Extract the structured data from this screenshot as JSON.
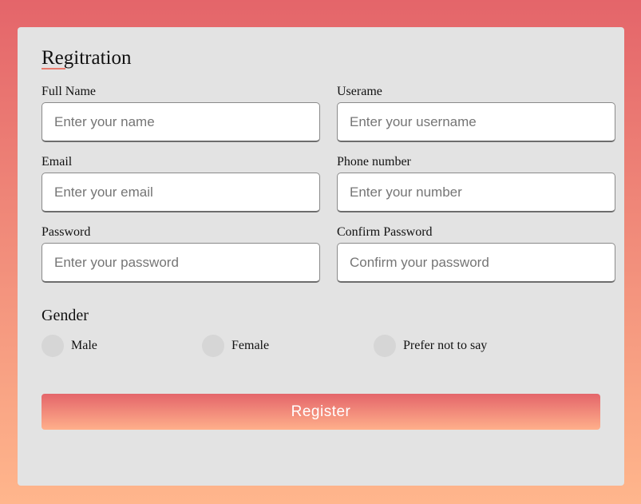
{
  "form": {
    "title": "Regitration",
    "fields": [
      {
        "label": "Full Name",
        "placeholder": "Enter your name",
        "value": ""
      },
      {
        "label": "Userame",
        "placeholder": "Enter your username",
        "value": ""
      },
      {
        "label": "Email",
        "placeholder": "Enter your email",
        "value": ""
      },
      {
        "label": "Phone number",
        "placeholder": "Enter your number",
        "value": ""
      },
      {
        "label": "Password",
        "placeholder": "Enter your password",
        "value": ""
      },
      {
        "label": "Confirm Password",
        "placeholder": "Confirm your password",
        "value": ""
      }
    ],
    "gender": {
      "title": "Gender",
      "options": [
        "Male",
        "Female",
        "Prefer not to say"
      ],
      "selected": null
    },
    "register_label": "Register"
  },
  "colors": {
    "background_top": "#e4656a",
    "background_bottom": "#ffb68c",
    "card": "#e3e3e3",
    "accent": "#e97b6e"
  }
}
